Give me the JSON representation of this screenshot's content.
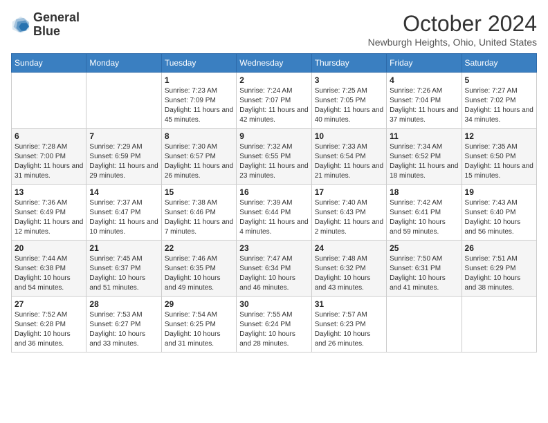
{
  "header": {
    "logo_line1": "General",
    "logo_line2": "Blue",
    "month_title": "October 2024",
    "location": "Newburgh Heights, Ohio, United States"
  },
  "weekdays": [
    "Sunday",
    "Monday",
    "Tuesday",
    "Wednesday",
    "Thursday",
    "Friday",
    "Saturday"
  ],
  "weeks": [
    [
      {
        "day": "",
        "sunrise": "",
        "sunset": "",
        "daylight": ""
      },
      {
        "day": "",
        "sunrise": "",
        "sunset": "",
        "daylight": ""
      },
      {
        "day": "1",
        "sunrise": "Sunrise: 7:23 AM",
        "sunset": "Sunset: 7:09 PM",
        "daylight": "Daylight: 11 hours and 45 minutes."
      },
      {
        "day": "2",
        "sunrise": "Sunrise: 7:24 AM",
        "sunset": "Sunset: 7:07 PM",
        "daylight": "Daylight: 11 hours and 42 minutes."
      },
      {
        "day": "3",
        "sunrise": "Sunrise: 7:25 AM",
        "sunset": "Sunset: 7:05 PM",
        "daylight": "Daylight: 11 hours and 40 minutes."
      },
      {
        "day": "4",
        "sunrise": "Sunrise: 7:26 AM",
        "sunset": "Sunset: 7:04 PM",
        "daylight": "Daylight: 11 hours and 37 minutes."
      },
      {
        "day": "5",
        "sunrise": "Sunrise: 7:27 AM",
        "sunset": "Sunset: 7:02 PM",
        "daylight": "Daylight: 11 hours and 34 minutes."
      }
    ],
    [
      {
        "day": "6",
        "sunrise": "Sunrise: 7:28 AM",
        "sunset": "Sunset: 7:00 PM",
        "daylight": "Daylight: 11 hours and 31 minutes."
      },
      {
        "day": "7",
        "sunrise": "Sunrise: 7:29 AM",
        "sunset": "Sunset: 6:59 PM",
        "daylight": "Daylight: 11 hours and 29 minutes."
      },
      {
        "day": "8",
        "sunrise": "Sunrise: 7:30 AM",
        "sunset": "Sunset: 6:57 PM",
        "daylight": "Daylight: 11 hours and 26 minutes."
      },
      {
        "day": "9",
        "sunrise": "Sunrise: 7:32 AM",
        "sunset": "Sunset: 6:55 PM",
        "daylight": "Daylight: 11 hours and 23 minutes."
      },
      {
        "day": "10",
        "sunrise": "Sunrise: 7:33 AM",
        "sunset": "Sunset: 6:54 PM",
        "daylight": "Daylight: 11 hours and 21 minutes."
      },
      {
        "day": "11",
        "sunrise": "Sunrise: 7:34 AM",
        "sunset": "Sunset: 6:52 PM",
        "daylight": "Daylight: 11 hours and 18 minutes."
      },
      {
        "day": "12",
        "sunrise": "Sunrise: 7:35 AM",
        "sunset": "Sunset: 6:50 PM",
        "daylight": "Daylight: 11 hours and 15 minutes."
      }
    ],
    [
      {
        "day": "13",
        "sunrise": "Sunrise: 7:36 AM",
        "sunset": "Sunset: 6:49 PM",
        "daylight": "Daylight: 11 hours and 12 minutes."
      },
      {
        "day": "14",
        "sunrise": "Sunrise: 7:37 AM",
        "sunset": "Sunset: 6:47 PM",
        "daylight": "Daylight: 11 hours and 10 minutes."
      },
      {
        "day": "15",
        "sunrise": "Sunrise: 7:38 AM",
        "sunset": "Sunset: 6:46 PM",
        "daylight": "Daylight: 11 hours and 7 minutes."
      },
      {
        "day": "16",
        "sunrise": "Sunrise: 7:39 AM",
        "sunset": "Sunset: 6:44 PM",
        "daylight": "Daylight: 11 hours and 4 minutes."
      },
      {
        "day": "17",
        "sunrise": "Sunrise: 7:40 AM",
        "sunset": "Sunset: 6:43 PM",
        "daylight": "Daylight: 11 hours and 2 minutes."
      },
      {
        "day": "18",
        "sunrise": "Sunrise: 7:42 AM",
        "sunset": "Sunset: 6:41 PM",
        "daylight": "Daylight: 10 hours and 59 minutes."
      },
      {
        "day": "19",
        "sunrise": "Sunrise: 7:43 AM",
        "sunset": "Sunset: 6:40 PM",
        "daylight": "Daylight: 10 hours and 56 minutes."
      }
    ],
    [
      {
        "day": "20",
        "sunrise": "Sunrise: 7:44 AM",
        "sunset": "Sunset: 6:38 PM",
        "daylight": "Daylight: 10 hours and 54 minutes."
      },
      {
        "day": "21",
        "sunrise": "Sunrise: 7:45 AM",
        "sunset": "Sunset: 6:37 PM",
        "daylight": "Daylight: 10 hours and 51 minutes."
      },
      {
        "day": "22",
        "sunrise": "Sunrise: 7:46 AM",
        "sunset": "Sunset: 6:35 PM",
        "daylight": "Daylight: 10 hours and 49 minutes."
      },
      {
        "day": "23",
        "sunrise": "Sunrise: 7:47 AM",
        "sunset": "Sunset: 6:34 PM",
        "daylight": "Daylight: 10 hours and 46 minutes."
      },
      {
        "day": "24",
        "sunrise": "Sunrise: 7:48 AM",
        "sunset": "Sunset: 6:32 PM",
        "daylight": "Daylight: 10 hours and 43 minutes."
      },
      {
        "day": "25",
        "sunrise": "Sunrise: 7:50 AM",
        "sunset": "Sunset: 6:31 PM",
        "daylight": "Daylight: 10 hours and 41 minutes."
      },
      {
        "day": "26",
        "sunrise": "Sunrise: 7:51 AM",
        "sunset": "Sunset: 6:29 PM",
        "daylight": "Daylight: 10 hours and 38 minutes."
      }
    ],
    [
      {
        "day": "27",
        "sunrise": "Sunrise: 7:52 AM",
        "sunset": "Sunset: 6:28 PM",
        "daylight": "Daylight: 10 hours and 36 minutes."
      },
      {
        "day": "28",
        "sunrise": "Sunrise: 7:53 AM",
        "sunset": "Sunset: 6:27 PM",
        "daylight": "Daylight: 10 hours and 33 minutes."
      },
      {
        "day": "29",
        "sunrise": "Sunrise: 7:54 AM",
        "sunset": "Sunset: 6:25 PM",
        "daylight": "Daylight: 10 hours and 31 minutes."
      },
      {
        "day": "30",
        "sunrise": "Sunrise: 7:55 AM",
        "sunset": "Sunset: 6:24 PM",
        "daylight": "Daylight: 10 hours and 28 minutes."
      },
      {
        "day": "31",
        "sunrise": "Sunrise: 7:57 AM",
        "sunset": "Sunset: 6:23 PM",
        "daylight": "Daylight: 10 hours and 26 minutes."
      },
      {
        "day": "",
        "sunrise": "",
        "sunset": "",
        "daylight": ""
      },
      {
        "day": "",
        "sunrise": "",
        "sunset": "",
        "daylight": ""
      }
    ]
  ]
}
